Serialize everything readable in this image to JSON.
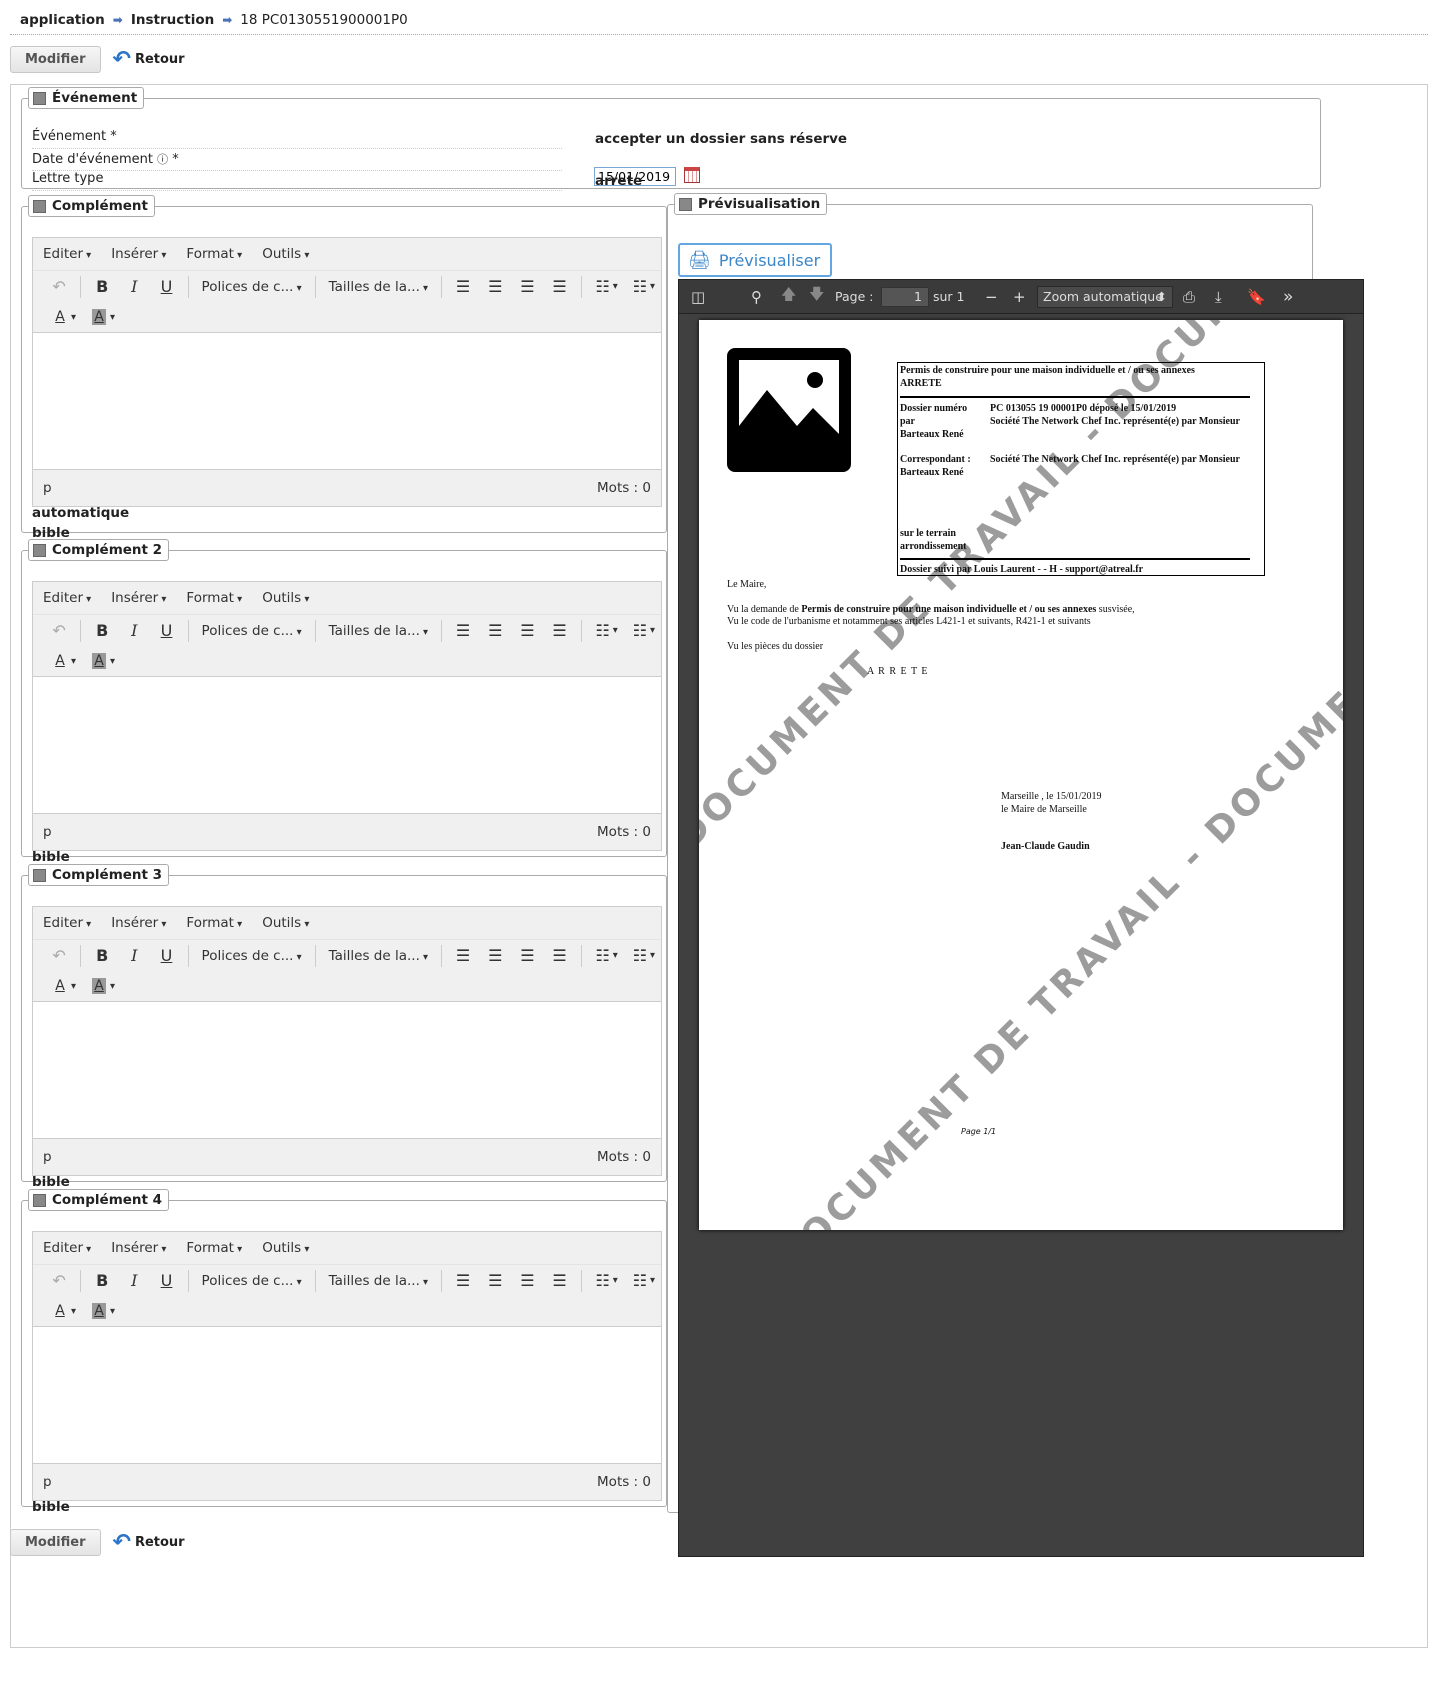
{
  "breadcrumb": {
    "items": [
      "application",
      "Instruction",
      "18 PC0130551900001P0"
    ]
  },
  "actions": {
    "modifier": "Modifier",
    "retour": "Retour"
  },
  "evenement": {
    "legend": "Événement",
    "rows": [
      {
        "label": "Événement *",
        "value": "accepter un dossier sans réserve"
      },
      {
        "label": "Date d'événement",
        "required": "*",
        "value": "15/01/2019"
      },
      {
        "label": "Lettre type",
        "value": "arrete"
      }
    ]
  },
  "editor": {
    "menu": [
      "Editer",
      "Insérer",
      "Format",
      "Outils"
    ],
    "font_family": "Polices de c...",
    "font_size": "Tailles de la...",
    "path": "p",
    "wordcount": "Mots : 0"
  },
  "complements": [
    {
      "legend": "Complément",
      "notes": [
        "automatique",
        "bible"
      ]
    },
    {
      "legend": "Complément 2",
      "notes": [
        "bible"
      ]
    },
    {
      "legend": "Complément 3",
      "notes": [
        "bible"
      ]
    },
    {
      "legend": "Complément 4",
      "notes": [
        "bible"
      ]
    }
  ],
  "preview": {
    "legend": "Prévisualisation",
    "button": "Prévisualiser",
    "toolbar": {
      "page_label": "Page :",
      "page_value": "1",
      "of": "sur 1",
      "zoom": "Zoom automatique"
    },
    "doc": {
      "box_title": "Permis de construire pour une maison individuelle et / ou ses annexes",
      "box_subtitle": "ARRETE",
      "dossier_label": "Dossier numéro",
      "par": "par",
      "dossier_value": "PC 013055 19 00001P0  déposé le 15/01/2019",
      "dossier_by": "Société The Network Chef Inc. représenté(e) par Monsieur",
      "owner": "Barteaux René",
      "corr_label": "Correspondant :",
      "corr_value": "Société The Network Chef Inc. représenté(e) par Monsieur",
      "corr_owner": "Barteaux René",
      "terrain": "sur le terrain",
      "arrondissement": "arrondissement",
      "suivi": "Dossier suivi par  Louis Laurent -  - H - support@atreal.fr",
      "maire": "Le Maire,",
      "vu1_pre": "Vu la demande de ",
      "vu1_bold": "Permis de construire pour une maison individuelle et / ou ses annexes",
      "vu1_post": " susvisée,",
      "vu2": "Vu le code de l'urbanisme et notamment ses articles L421-1 et suivants, R421-1 et suivants",
      "vu3": "Vu les pièces du dossier",
      "arrete": "A R R E T E",
      "sig1": "Marseille , le  15/01/2019",
      "sig2": "le Maire de Marseille",
      "sig3": "Jean-Claude Gaudin",
      "pagenum": "Page 1/1",
      "watermark": "DOCUMENT DE TRAVAIL - DOCUMENT DE TRAVAIL - DOCUMENT DE TRAVAIL"
    }
  }
}
